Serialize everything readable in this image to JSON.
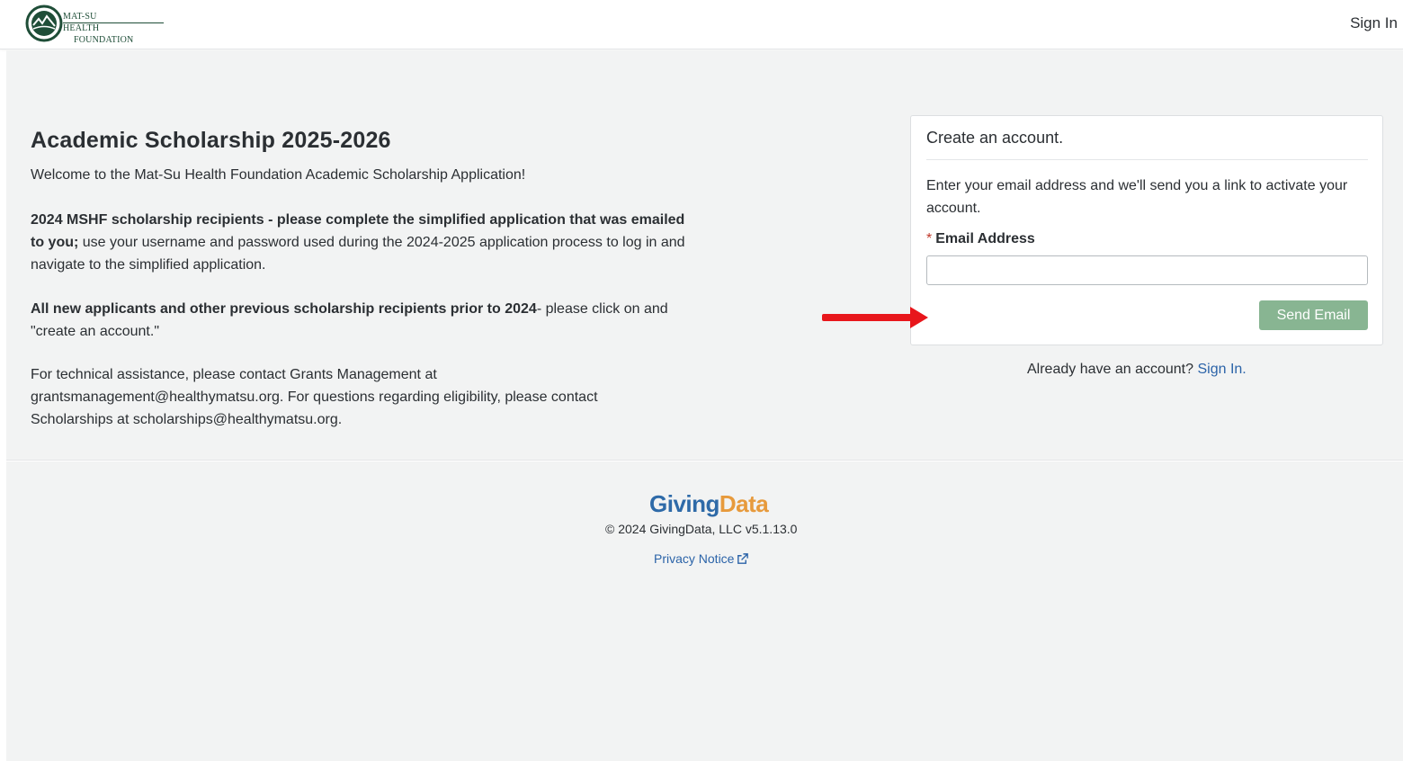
{
  "header": {
    "logo_line1": "MAT-SU HEALTH",
    "logo_line2": "FOUNDATION",
    "signin_label": "Sign In"
  },
  "main": {
    "title": "Academic Scholarship 2025-2026",
    "welcome": "Welcome to the Mat-Su Health Foundation Academic Scholarship Application!",
    "para2_bold": "2024 MSHF scholarship recipients - please complete the simplified application that was emailed to you;",
    "para2_rest": " use your username and password used during the 2024-2025 application process to log in and navigate to the simplified application.",
    "para3_bold": "All new applicants and other previous scholarship recipients prior to 2024",
    "para3_rest": "- please click on and \"create an account.\"",
    "para4": "For technical assistance, please contact Grants Management at grantsmanagement@healthymatsu.org. For questions regarding eligibility, please contact Scholarships at scholarships@healthymatsu.org."
  },
  "card": {
    "title": "Create an account.",
    "description": "Enter your email address and we'll send you a link to activate your account.",
    "required_mark": "*",
    "email_label": "Email Address",
    "email_value": "",
    "send_label": "Send Email"
  },
  "signin_prompt": {
    "text": "Already have an account? ",
    "link": "Sign In."
  },
  "footer": {
    "logo_part1": "Giving",
    "logo_part2": "Data",
    "copyright": "© 2024 GivingData, LLC v5.1.13.0",
    "privacy_label": "Privacy Notice"
  },
  "colors": {
    "accent_green": "#88b592",
    "link_blue": "#2b63a8",
    "arrow_red": "#e8161b"
  }
}
